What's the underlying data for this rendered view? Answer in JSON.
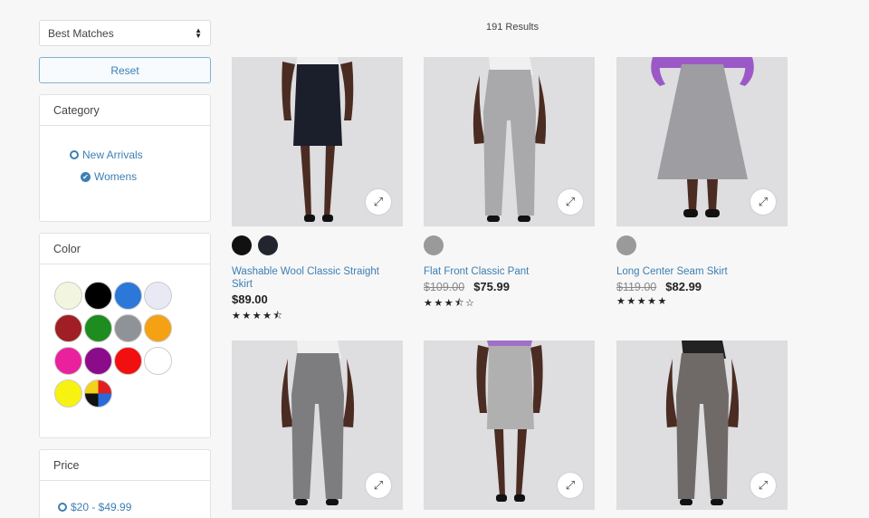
{
  "sort": {
    "value": "Best Matches",
    "arrows_icon": "sort-arrows-icon"
  },
  "reset_label": "Reset",
  "category": {
    "title": "Category",
    "items": [
      {
        "label": "New Arrivals",
        "selected": false
      },
      {
        "label": "Womens",
        "selected": true
      }
    ]
  },
  "color": {
    "title": "Color",
    "swatches": [
      "#f3f6df",
      "#000000",
      "#2b78d8",
      "#e8e9f4",
      "#a01f24",
      "#1e8c1e",
      "#8f9398",
      "#f5a114",
      "#e9219c",
      "#8a0c8a",
      "#f20f0f",
      "#ffffff",
      "#f7f20f",
      "multicolor"
    ]
  },
  "price": {
    "title": "Price",
    "items": [
      {
        "label": "$20 - $49.99"
      }
    ]
  },
  "results": {
    "count_text": "191 Results"
  },
  "products": [
    {
      "name": "Washable Wool Classic Straight Skirt",
      "old_price": "",
      "price": "$89.00",
      "stars": "★★★★⯪",
      "swatches": [
        "#111111",
        "#22252e"
      ],
      "garment": "#1b1e2b",
      "top": "#f0f0f0",
      "style": "skirt-short"
    },
    {
      "name": "Flat Front Classic Pant",
      "old_price": "$109.00",
      "price": "$75.99",
      "stars": "★★★⯪☆",
      "swatches": [
        "#9a9a9a"
      ],
      "garment": "#a9a9ab",
      "top": "#f0f0f0",
      "style": "pant"
    },
    {
      "name": "Long Center Seam Skirt",
      "old_price": "$119.00",
      "price": "$82.99",
      "stars": "★★★★★",
      "swatches": [
        "#9a9a9a"
      ],
      "garment": "#9e9ea2",
      "top": "#9b59c7",
      "style": "skirt-long"
    },
    {
      "name": "",
      "old_price": "",
      "price": "",
      "stars": "",
      "swatches": [],
      "garment": "#7d7d80",
      "top": "#f0f0f0",
      "style": "pant"
    },
    {
      "name": "",
      "old_price": "",
      "price": "",
      "stars": "",
      "swatches": [],
      "garment": "#b0b0b0",
      "top": "#a070c8",
      "style": "skirt-pencil"
    },
    {
      "name": "",
      "old_price": "",
      "price": "",
      "stars": "",
      "swatches": [],
      "garment": "#6f6a68",
      "top": "#222222",
      "style": "pant"
    }
  ]
}
